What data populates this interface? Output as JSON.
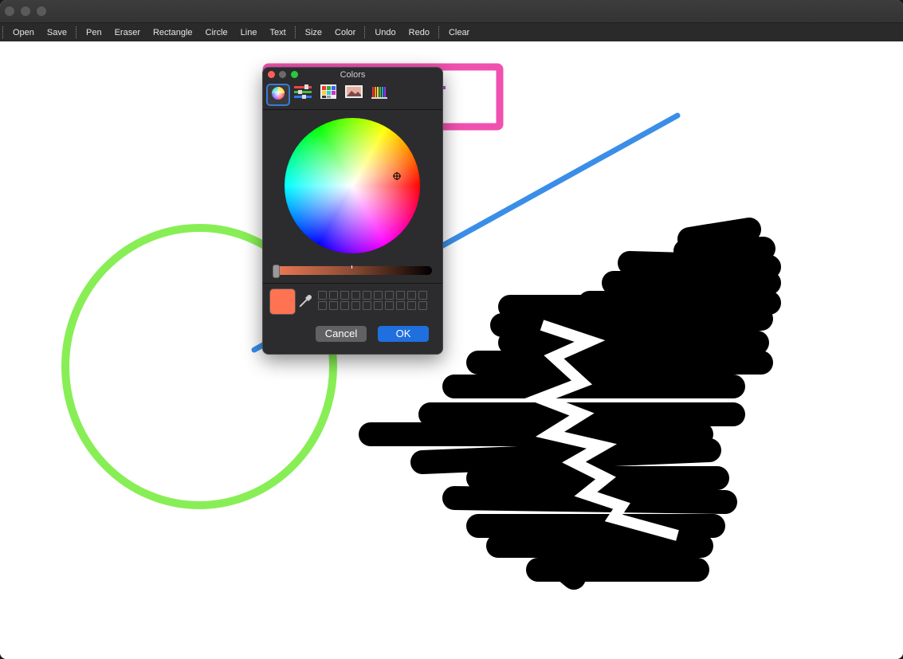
{
  "toolbar": {
    "groups": [
      [
        "Open",
        "Save"
      ],
      [
        "Pen",
        "Eraser",
        "Rectangle",
        "Circle",
        "Line",
        "Text"
      ],
      [
        "Size",
        "Color"
      ],
      [
        "Undo",
        "Redo"
      ],
      [
        "Clear"
      ]
    ]
  },
  "color_panel": {
    "title": "Colors",
    "modes": [
      "color-wheel-icon",
      "color-sliders-icon",
      "color-palettes-icon",
      "image-palettes-icon",
      "pencils-icon"
    ],
    "selected_mode": "color-wheel-icon",
    "brightness_level": 0.0,
    "current_color": "#ff7352",
    "cancel_label": "Cancel",
    "ok_label": "OK"
  },
  "canvas": {
    "stroke_colors": {
      "rectangle": "#f050b0",
      "line": "#3a8ee8",
      "circle": "#88ee55",
      "scribble": "#000000",
      "eraser": "#ffffff",
      "purple_mark": "#9955cc"
    }
  }
}
